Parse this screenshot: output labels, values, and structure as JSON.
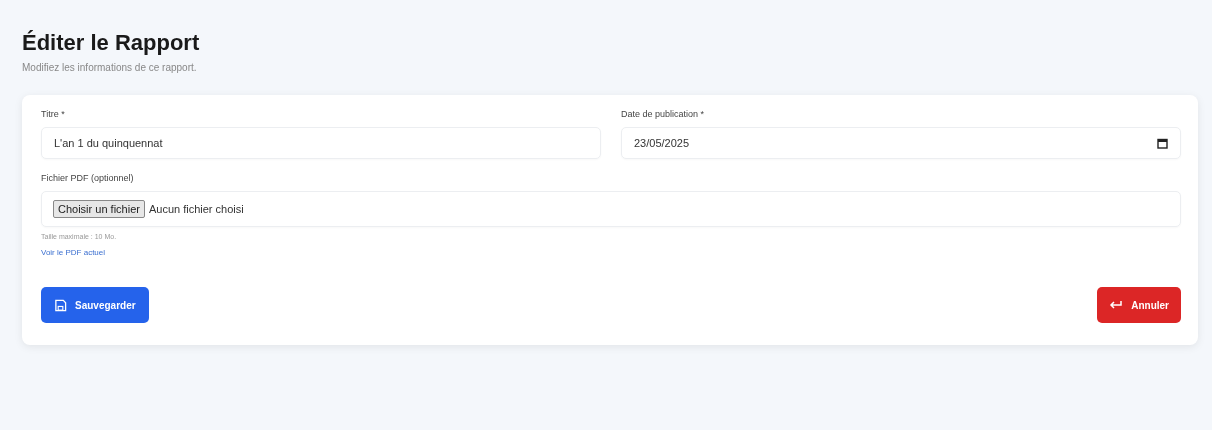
{
  "header": {
    "title": "Éditer le Rapport",
    "subtitle": "Modifiez les informations de ce rapport."
  },
  "form": {
    "title_field": {
      "label": "Titre *",
      "value": "L'an 1 du quinquennat"
    },
    "date_field": {
      "label": "Date de publication *",
      "value": "23/05/2025"
    },
    "file_field": {
      "label": "Fichier PDF (optionnel)",
      "button": "Choisir un fichier",
      "status": "Aucun fichier choisi",
      "hint": "Taille maximale : 10 Mo.",
      "link": "Voir le PDF actuel"
    }
  },
  "actions": {
    "save": "Sauvegarder",
    "cancel": "Annuler"
  }
}
